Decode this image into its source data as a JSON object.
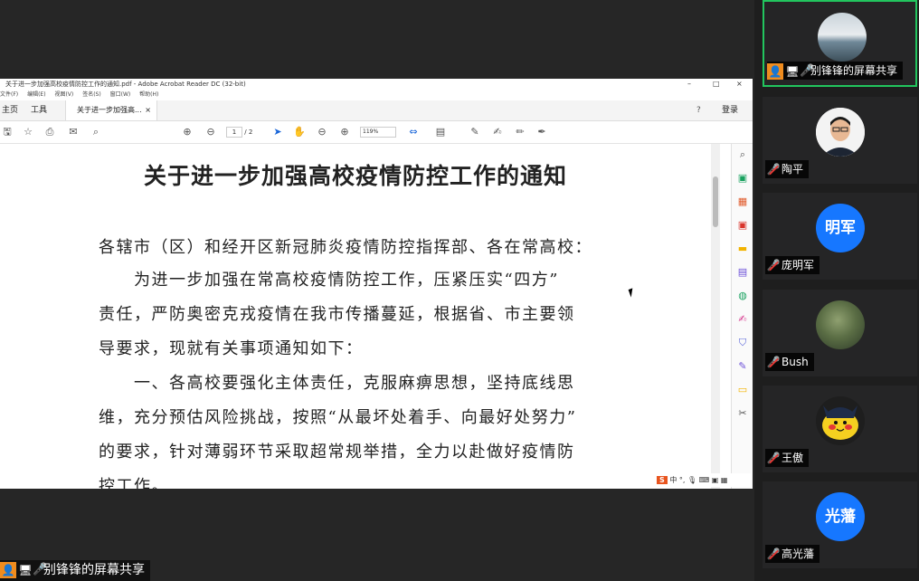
{
  "acrobat": {
    "window_title": "关于进一步加强高校疫情防控工作的通知.pdf - Adobe Acrobat Reader DC (32-bit)",
    "menu": [
      "文件(F)",
      "编辑(E)",
      "视图(V)",
      "签名(S)",
      "窗口(W)",
      "帮助(H)"
    ],
    "tabs": {
      "home": "主页",
      "tools": "工具",
      "doc": "关于进一步加强高...",
      "close": "×"
    },
    "help_icon": "?",
    "signin": "登录",
    "page_current": "1",
    "page_total": "/ 2",
    "zoom": "119%",
    "window_controls": {
      "minimize": "–",
      "maximize": "□",
      "close": "×"
    }
  },
  "document": {
    "title": "关于进一步加强高校疫情防控工作的通知",
    "lines": [
      "各辖市（区）和经开区新冠肺炎疫情防控指挥部、各在常高校：",
      "　　为进一步加强在常高校疫情防控工作，压紧压实“四方”",
      "责任，严防奥密克戎疫情在我市传播蔓延，根据省、市主要领",
      "导要求，现就有关事项通知如下：",
      "　　一、各高校要强化主体责任，克服麻痹思想，坚持底线思",
      "维，充分预估风险挑战，按照“从最坏处着手、向最好处努力”",
      "的要求，针对薄弱环节采取超常规举措，全力以赴做好疫情防",
      "控工作。"
    ]
  },
  "ime": {
    "logo": "S",
    "mode": "中"
  },
  "sharer": {
    "label": "别锋锋的屏幕共享"
  },
  "participants": [
    {
      "name": "别锋锋的屏幕共享",
      "avatar_text": "",
      "avatar_color": "#8aa0b0",
      "muted": false,
      "active": true
    },
    {
      "name": "陶平",
      "avatar_text": "",
      "avatar_color": "#e9e9e9",
      "muted": true,
      "active": false
    },
    {
      "name": "庞明军",
      "avatar_text": "明军",
      "avatar_color": "#1677ff",
      "muted": true,
      "active": false
    },
    {
      "name": "Bush",
      "avatar_text": "",
      "avatar_color": "#5b6e45",
      "muted": true,
      "active": false
    },
    {
      "name": "王傲",
      "avatar_text": "",
      "avatar_color": "#f5d020",
      "muted": true,
      "active": false
    },
    {
      "name": "高光藩",
      "avatar_text": "光藩",
      "avatar_color": "#1677ff",
      "muted": true,
      "active": false
    }
  ]
}
